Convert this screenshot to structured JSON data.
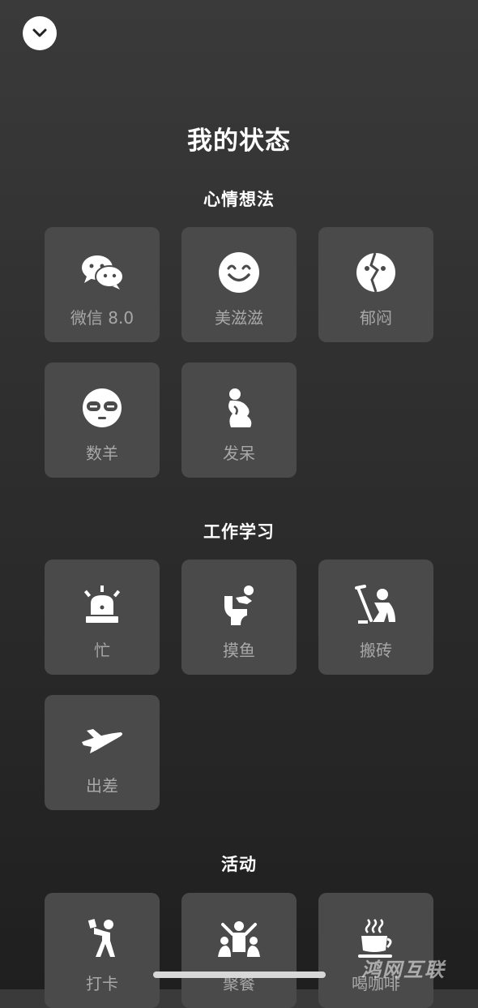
{
  "header": {
    "title": "我的状态"
  },
  "sections": [
    {
      "title": "心情想法",
      "items": [
        {
          "label": "微信 8.0",
          "icon": "wechat-icon"
        },
        {
          "label": "美滋滋",
          "icon": "smiley-face-icon"
        },
        {
          "label": "郁闷",
          "icon": "broken-face-icon"
        },
        {
          "label": "数羊",
          "icon": "sleep-mask-face-icon"
        },
        {
          "label": "发呆",
          "icon": "daze-figure-icon"
        }
      ]
    },
    {
      "title": "工作学习",
      "items": [
        {
          "label": "忙",
          "icon": "alarm-siren-icon"
        },
        {
          "label": "摸鱼",
          "icon": "toilet-sitting-icon"
        },
        {
          "label": "搬砖",
          "icon": "worker-icon"
        },
        {
          "label": "出差",
          "icon": "airplane-icon"
        }
      ]
    },
    {
      "title": "活动",
      "items": [
        {
          "label": "打卡",
          "icon": "walking-figure-icon"
        },
        {
          "label": "聚餐",
          "icon": "group-cheer-icon"
        },
        {
          "label": "喝咖啡",
          "icon": "coffee-cup-icon"
        }
      ]
    }
  ],
  "watermark": "鸿网互联"
}
